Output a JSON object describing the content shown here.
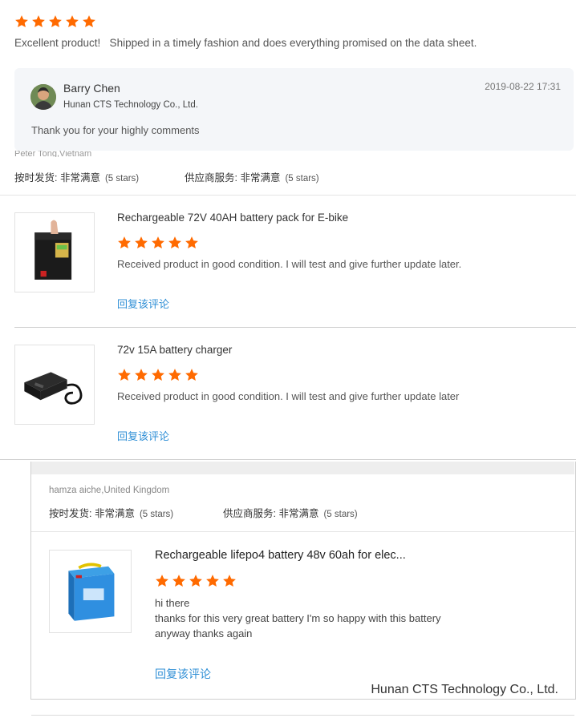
{
  "top_review": {
    "comment": "Excellent product!   Shipped in a timely fashion and does everything promised on the data sheet.",
    "rating": 5
  },
  "reply": {
    "author": "Barry Chen",
    "company": "Hunan CTS Technology Co., Ltd.",
    "timestamp": "2019-08-22 17:31",
    "text": "Thank you for your highly comments"
  },
  "review1": {
    "reviewer": "Peter Tong,Vietnam",
    "delivery_label": "按时发货: 非常满意",
    "delivery_stars": "(5 stars)",
    "service_label": "供应商服务: 非常满意",
    "service_stars": "(5 stars)",
    "items": [
      {
        "title": "Rechargeable 72V 40AH battery pack for E-bike",
        "rating": 5,
        "comment": "Received product in good condition. I will test and give further update later.",
        "reply_link": "回复该评论"
      },
      {
        "title": "72v 15A battery charger",
        "rating": 5,
        "comment": "Received product in good condition. I will test and give further update later",
        "reply_link": "回复该评论"
      }
    ]
  },
  "review2": {
    "reviewer": "hamza aiche,United Kingdom",
    "delivery_label": "按时发货: 非常满意",
    "delivery_stars": "(5 stars)",
    "service_label": "供应商服务: 非常满意",
    "service_stars": "(5 stars)",
    "item": {
      "title": "Rechargeable lifepo4 battery 48v 60ah for elec...",
      "rating": 5,
      "comment_lines": [
        "hi there",
        "thanks for this very great battery I'm so happy with this battery",
        "anyway thanks again"
      ],
      "reply_link": "回复该评论"
    }
  },
  "watermark": "Hunan CTS Technology Co., Ltd.",
  "colors": {
    "star": "#ff6a00",
    "link": "#2f8fd6",
    "reply_bg": "#f4f6f9"
  }
}
